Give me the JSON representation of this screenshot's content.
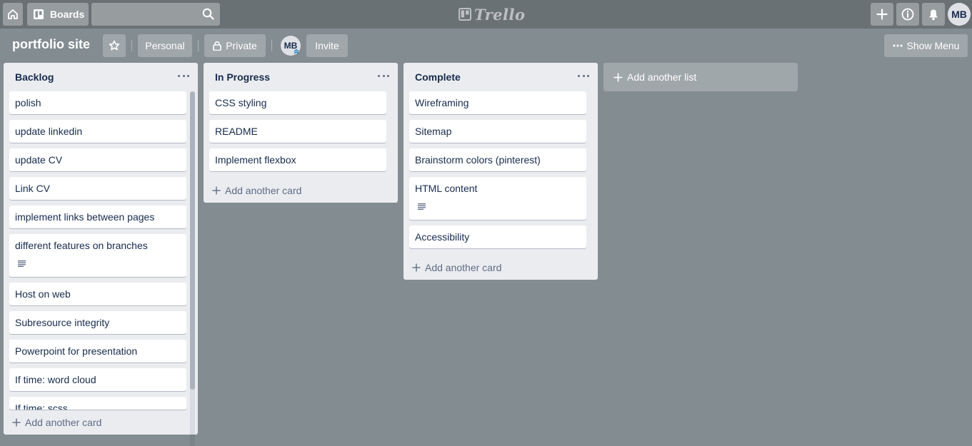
{
  "header": {
    "boards_label": "Boards",
    "search_placeholder": "",
    "logo_text": "Trello",
    "user_initials": "MB"
  },
  "board": {
    "title": "portfolio site",
    "team_label": "Personal",
    "visibility_label": "Private",
    "member_initials": "MB",
    "invite_label": "Invite",
    "show_menu_label": "Show Menu"
  },
  "lists": [
    {
      "name": "Backlog",
      "cards": [
        "polish",
        "update linkedin",
        "update CV",
        "Link CV",
        "implement links between pages",
        "different features on branches",
        "Host on web",
        "Subresource integrity",
        "Powerpoint for presentation",
        "If time: word cloud",
        "If time: scss"
      ],
      "add_card_label": "Add another card"
    },
    {
      "name": "In Progress",
      "cards": [
        "CSS styling",
        "README",
        "Implement flexbox"
      ],
      "add_card_label": "Add another card"
    },
    {
      "name": "Complete",
      "cards": [
        "Wireframing",
        "Sitemap",
        "Brainstorm colors (pinterest)",
        "HTML content",
        "Accessibility"
      ],
      "add_card_label": "Add another card"
    }
  ],
  "add_list_label": "Add another list",
  "colors": {
    "board_background": "#838c91",
    "header_background": "#6a7175",
    "list_background": "#ebecf0",
    "card_background": "#ffffff",
    "text": "#172b4d",
    "muted_text": "#5e6c84"
  }
}
